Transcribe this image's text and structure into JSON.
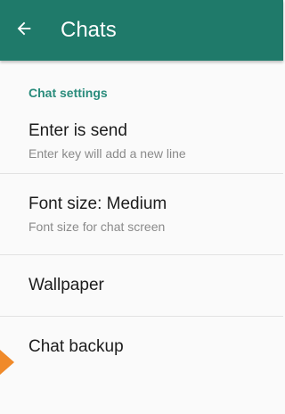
{
  "appbar": {
    "title": "Chats",
    "back_icon": "arrow-left-icon",
    "color": "#1f7a6a"
  },
  "section": {
    "header": "Chat settings",
    "header_color": "#2a8c7c"
  },
  "items": [
    {
      "title": "Enter is send",
      "subtitle": "Enter key will add a new line"
    },
    {
      "title": "Font size: Medium",
      "subtitle": "Font size for chat screen"
    },
    {
      "title": "Wallpaper"
    },
    {
      "title": "Chat backup"
    }
  ],
  "accent_color": "#f08a2a"
}
